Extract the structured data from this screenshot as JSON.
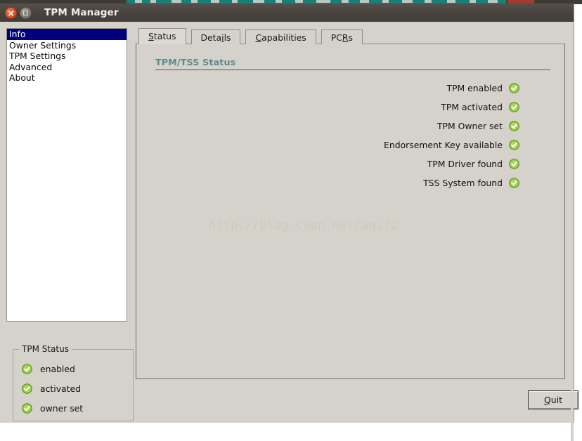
{
  "window": {
    "title": "TPM Manager",
    "controls": [
      {
        "name": "close",
        "icon": "close-icon"
      },
      {
        "name": "maximize",
        "icon": "maximize-icon"
      }
    ]
  },
  "sidebar": {
    "items": [
      {
        "label": "Info",
        "selected": true
      },
      {
        "label": "Owner Settings",
        "selected": false
      },
      {
        "label": "TPM Settings",
        "selected": false
      },
      {
        "label": "Advanced",
        "selected": false
      },
      {
        "label": "About",
        "selected": false
      }
    ]
  },
  "tpm_status_group": {
    "legend": "TPM Status",
    "rows": [
      {
        "label": "enabled",
        "icon": "check-circle-icon",
        "state": "ok"
      },
      {
        "label": "activated",
        "icon": "check-circle-icon",
        "state": "ok"
      },
      {
        "label": "owner set",
        "icon": "check-circle-icon",
        "state": "ok"
      }
    ]
  },
  "tabs": [
    {
      "label": "Status",
      "mnemonic_index": 1,
      "active": true
    },
    {
      "label": "Details",
      "mnemonic_index": 4,
      "active": false
    },
    {
      "label": "Capabilities",
      "mnemonic_index": 0,
      "active": false
    },
    {
      "label": "PCRs",
      "mnemonic_index": 2,
      "active": false
    }
  ],
  "status_panel": {
    "section_title": "TPM/TSS Status",
    "rows": [
      {
        "label": "TPM enabled",
        "icon": "check-circle-icon",
        "state": "ok"
      },
      {
        "label": "TPM activated",
        "icon": "check-circle-icon",
        "state": "ok"
      },
      {
        "label": "TPM Owner set",
        "icon": "check-circle-icon",
        "state": "ok"
      },
      {
        "label": "Endorsement Key available",
        "icon": "check-circle-icon",
        "state": "ok"
      },
      {
        "label": "TPM Driver found",
        "icon": "check-circle-icon",
        "state": "ok"
      },
      {
        "label": "TSS System found",
        "icon": "check-circle-icon",
        "state": "ok"
      }
    ]
  },
  "watermark": {
    "text": "http://blog.csdn.net/aqifz"
  },
  "footer": {
    "quit_label": "Quit",
    "quit_mnemonic_index": 0
  },
  "colors": {
    "window_background": "#d5d2cb",
    "titlebar": "#48433e",
    "selection": "#00007f",
    "section_title": "#5b8a8c",
    "status_ok": "#7ec12a",
    "watermark": "#cdc9c1"
  }
}
